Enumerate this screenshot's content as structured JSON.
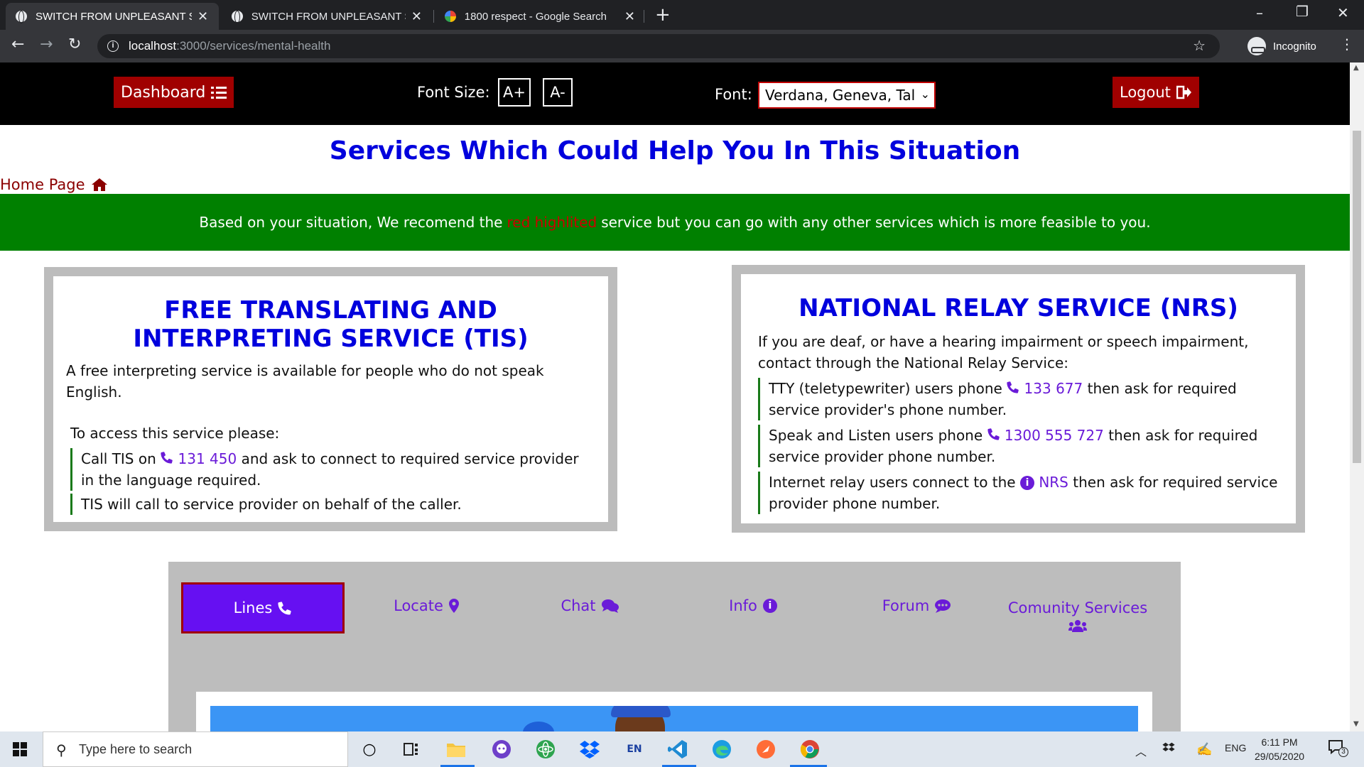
{
  "browser": {
    "tabs": [
      {
        "title": "SWITCH FROM UNPLEASANT SC",
        "active": true
      },
      {
        "title": "SWITCH FROM UNPLEASANT SC",
        "active": false
      },
      {
        "title": "1800 respect - Google Search",
        "active": false
      }
    ],
    "url_host": "localhost",
    "url_path": ":3000/services/mental-health",
    "profile_label": "Incognito"
  },
  "appbar": {
    "dashboard_label": "Dashboard",
    "font_size_label": "Font Size:",
    "increase_label": "A+",
    "decrease_label": "A-",
    "font_label": "Font:",
    "font_value": "Verdana, Geneva, Tal",
    "logout_label": "Logout"
  },
  "page": {
    "title": "Services Which Could Help You In This Situation",
    "home_link": "Home Page",
    "banner_pre": "Based on your situation, We recomend the",
    "banner_highlight": "red highlited",
    "banner_post": "service but you can go with any other services which is more feasible to you.",
    "colors": {
      "banner_bg": "#008000",
      "highlight": "#cc0000",
      "title": "#0000dd",
      "accent": "#6610f2",
      "button_red": "#a00000"
    }
  },
  "tis": {
    "title_line1": "FREE TRANSLATING AND",
    "title_line2": "INTERPRETING SERVICE (TIS)",
    "desc": "A free interpreting service is available for people who do not speak English.",
    "access_intro": "To access this service please:",
    "bullet1_pre": "Call TIS on",
    "bullet1_phone": "131 450",
    "bullet1_post": "and ask to connect to required service provider in the language required.",
    "bullet2": "TIS will call to service provider on behalf of the caller."
  },
  "nrs": {
    "title": "NATIONAL RELAY SERVICE (NRS)",
    "desc": "If you are deaf, or have a hearing impairment or speech impairment, contact through the National Relay Service:",
    "bullet1_pre": "TTY (teletypewriter) users phone",
    "bullet1_phone": "133 677",
    "bullet1_post": "then ask for required service provider's phone number.",
    "bullet2_pre": "Speak and Listen users phone",
    "bullet2_phone": "1300 555 727",
    "bullet2_post": "then ask for required service provider phone number.",
    "bullet3_pre": "Internet relay users connect to the",
    "bullet3_link": "NRS",
    "bullet3_post": "then ask for required service provider phone number."
  },
  "service_tabs": [
    {
      "label": "Lines",
      "icon": "phone-icon",
      "active": true
    },
    {
      "label": "Locate",
      "icon": "map-marker-icon",
      "active": false
    },
    {
      "label": "Chat",
      "icon": "comments-icon",
      "active": false
    },
    {
      "label": "Info",
      "icon": "info-circle-icon",
      "active": false
    },
    {
      "label": "Forum",
      "icon": "comment-dots-icon",
      "active": false
    },
    {
      "label": "Comunity Services",
      "icon": "users-icon",
      "active": false
    }
  ],
  "taskbar": {
    "search_placeholder": "Type here to search",
    "lang": "ENG",
    "time": "6:11 PM",
    "date": "29/05/2020",
    "notification_count": "3",
    "lang_badge": "EN"
  }
}
